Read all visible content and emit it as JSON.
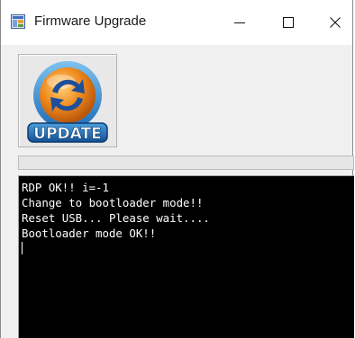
{
  "window": {
    "title": "Firmware Upgrade",
    "minimize_label": "—",
    "maximize_label": "☐",
    "close_label": "✕"
  },
  "update_button": {
    "label": "UPDATE"
  },
  "progress": {
    "value_percent": 0
  },
  "console": {
    "lines": [
      "RDP OK!! i=-1",
      "Change to bootloader mode!!",
      "Reset USB... Please wait....",
      "Bootloader mode OK!!"
    ]
  },
  "colors": {
    "console_bg": "#000000",
    "console_text": "#ffffff",
    "icon_orange": "#f08a1c",
    "icon_blue": "#1e6bb8"
  }
}
